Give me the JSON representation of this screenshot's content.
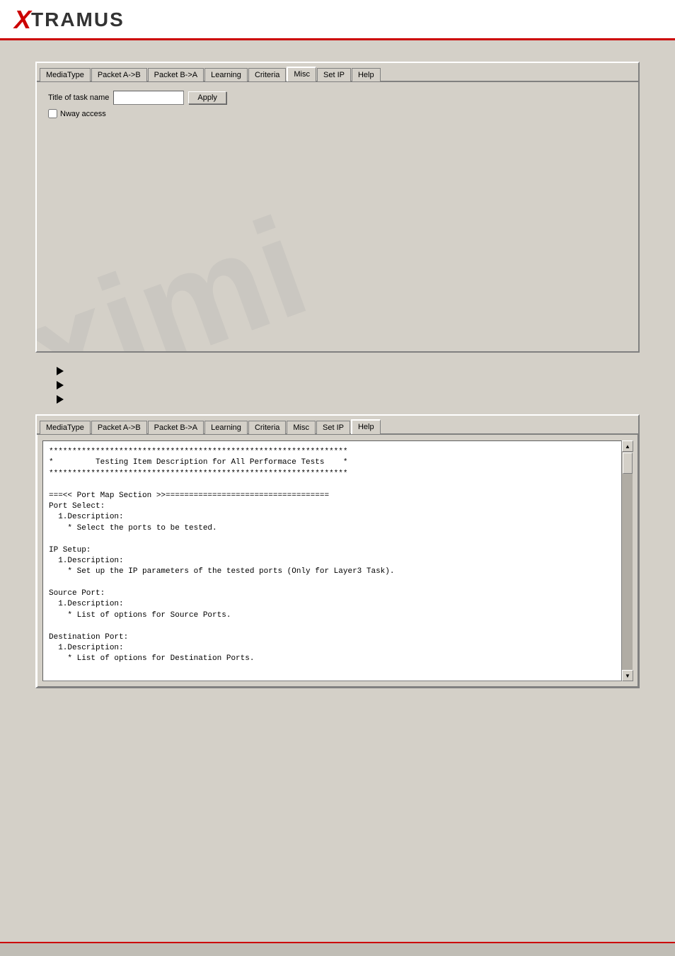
{
  "header": {
    "logo_x": "X",
    "logo_rest": "TRAMUS"
  },
  "panel1": {
    "tabs": [
      {
        "id": "mediatype",
        "label": "MediaType"
      },
      {
        "id": "packetab",
        "label": "Packet A->B"
      },
      {
        "id": "packetba",
        "label": "Packet B->A"
      },
      {
        "id": "learning",
        "label": "Learning"
      },
      {
        "id": "criteria",
        "label": "Criteria"
      },
      {
        "id": "misc",
        "label": "Misc",
        "active": true
      },
      {
        "id": "setip",
        "label": "Set IP"
      },
      {
        "id": "help",
        "label": "Help"
      }
    ],
    "body": {
      "title_label": "Title of task name",
      "apply_btn": "Apply",
      "checkbox_label": "Nway access"
    }
  },
  "bullets": [
    {
      "id": "b1"
    },
    {
      "id": "b2"
    },
    {
      "id": "b3"
    }
  ],
  "panel2": {
    "tabs": [
      {
        "id": "mediatype",
        "label": "MediaType"
      },
      {
        "id": "packetab",
        "label": "Packet A->B"
      },
      {
        "id": "packetba",
        "label": "Packet B->A"
      },
      {
        "id": "learning",
        "label": "Learning"
      },
      {
        "id": "criteria",
        "label": "Criteria"
      },
      {
        "id": "misc",
        "label": "Misc"
      },
      {
        "id": "setip",
        "label": "Set IP"
      },
      {
        "id": "help",
        "label": "Help",
        "active": true
      }
    ],
    "help_lines": [
      "****************************************************************",
      "*         Testing Item Description for All Performace Tests    *",
      "****************************************************************",
      "",
      "===<< Port Map Section >>===================================",
      "Port Select:",
      "  1.Description:",
      "    * Select the ports to be tested.",
      "",
      "IP Setup:",
      "  1.Description:",
      "    * Set up the IP parameters of the tested ports (Only for Layer3 Task).",
      "",
      "Source Port:",
      "  1.Description:",
      "    * List of options for Source Ports.",
      "",
      "Destination Port:",
      "  1.Description:",
      "    * List of options for Destination Ports."
    ]
  }
}
